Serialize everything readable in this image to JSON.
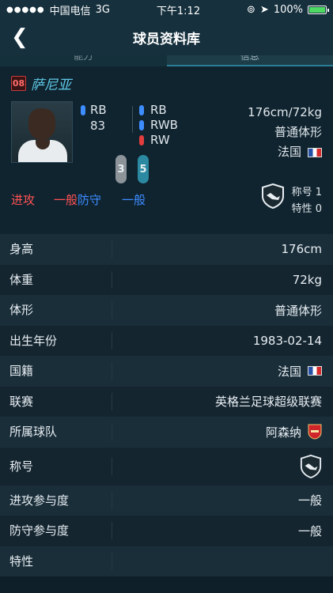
{
  "status": {
    "carrier": "中国电信",
    "network": "3G",
    "time": "下午1:12",
    "battery": "100%",
    "battery_fraction": 1.0
  },
  "nav": {
    "title": "球员资料库",
    "back_icon": "chevron-left-icon"
  },
  "tabs": [
    {
      "label": "能力"
    },
    {
      "label": "信息"
    }
  ],
  "player": {
    "number": "08",
    "name": "萨尼亚",
    "main_position": "RB",
    "rating": "83",
    "alt_positions": [
      {
        "label": "RB",
        "color": "#3d8dff"
      },
      {
        "label": "RWB",
        "color": "#3d8dff"
      },
      {
        "label": "RW",
        "color": "#e23d3d"
      }
    ],
    "weak_foot": "3",
    "strong_foot": "5",
    "height_weight": "176cm/72kg",
    "body_type": "普通体形",
    "nation": "法国",
    "attack_label": "进攻",
    "attack_value": "一般",
    "defense_label": "防守",
    "defense_value": "一般",
    "title_label": "称号",
    "title_count": "1",
    "trait_label": "特性",
    "trait_count": "0"
  },
  "details": [
    {
      "label": "身高",
      "value": "176cm"
    },
    {
      "label": "体重",
      "value": "72kg"
    },
    {
      "label": "体形",
      "value": "普通体形"
    },
    {
      "label": "出生年份",
      "value": "1983-02-14"
    },
    {
      "label": "国籍",
      "value": "法国"
    },
    {
      "label": "联赛",
      "value": "英格兰足球超级联赛"
    },
    {
      "label": "所属球队",
      "value": "阿森纳"
    },
    {
      "label": "称号",
      "value": ""
    },
    {
      "label": "进攻参与度",
      "value": "一般"
    },
    {
      "label": "防守参与度",
      "value": "一般"
    },
    {
      "label": "特性",
      "value": ""
    }
  ]
}
